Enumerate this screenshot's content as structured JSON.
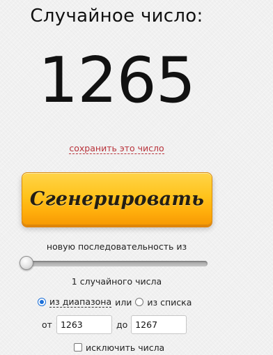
{
  "result": {
    "heading": "Случайное число:",
    "number": "1265",
    "save_link": "сохранить это число"
  },
  "generate_button": {
    "label": "Сгенерировать"
  },
  "sequence": {
    "label": "новую последовательность из",
    "slider_value": 1,
    "count_text": "1 случайного числа"
  },
  "mode": {
    "range_option": "из диапазона",
    "or_text": "или",
    "list_option": "из списка",
    "selected": "range"
  },
  "range": {
    "from_label": "от",
    "from_value": "1263",
    "to_label": "до",
    "to_value": "1267"
  },
  "exclude": {
    "label": "исключить числа",
    "checked": false
  },
  "colors": {
    "accent_link": "#b8323a",
    "button_orange": "#ffae0c",
    "radio_blue": "#1b6fd8",
    "background": "#f1f1f1"
  }
}
